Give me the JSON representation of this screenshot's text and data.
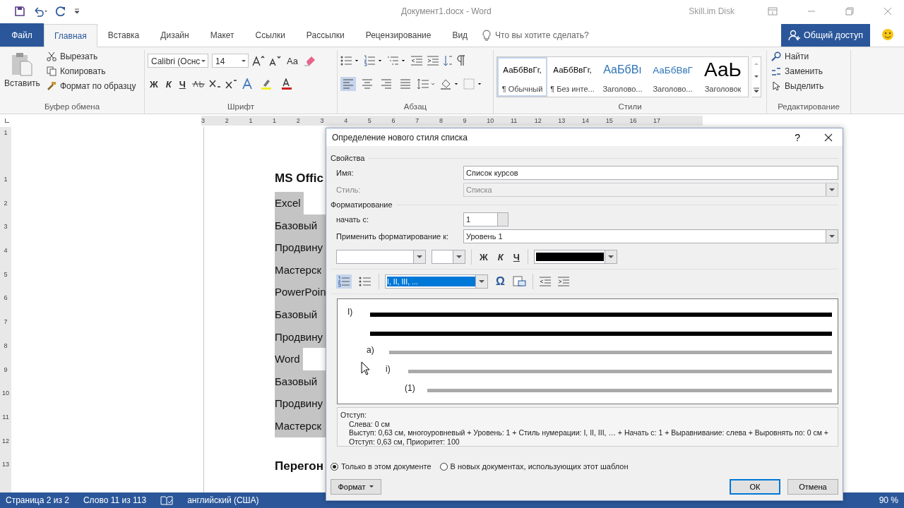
{
  "title_bar": {
    "title": "Документ1.docx - Word",
    "user": "Skill.im Disk"
  },
  "tabs": [
    {
      "label": "Файл",
      "kind": "file",
      "selected": false
    },
    {
      "label": "Главная",
      "kind": "tab",
      "selected": true
    },
    {
      "label": "Вставка",
      "kind": "tab",
      "selected": false
    },
    {
      "label": "Дизайн",
      "kind": "tab",
      "selected": false
    },
    {
      "label": "Макет",
      "kind": "tab",
      "selected": false
    },
    {
      "label": "Ссылки",
      "kind": "tab",
      "selected": false
    },
    {
      "label": "Рассылки",
      "kind": "tab",
      "selected": false
    },
    {
      "label": "Рецензирование",
      "kind": "tab",
      "selected": false
    },
    {
      "label": "Вид",
      "kind": "tab",
      "selected": false
    }
  ],
  "tell_me": {
    "placeholder": "Что вы хотите сделать?"
  },
  "share_button": "Общий доступ",
  "ribbon": {
    "clipboard": {
      "label": "Буфер обмена",
      "paste": "Вставить",
      "cut": "Вырезать",
      "copy": "Копировать",
      "format_painter": "Формат по образцу"
    },
    "font": {
      "label": "Шрифт",
      "name": "Calibri (Оснс",
      "size": "14",
      "case": "Аа",
      "bold": "Ж",
      "italic": "К",
      "underline": "Ч"
    },
    "paragraph": {
      "label": "Абзац",
      "alignments": [
        {
          "selected": true
        },
        {
          "selected": false
        },
        {
          "selected": false
        },
        {
          "selected": false
        }
      ]
    },
    "styles": {
      "label": "Стили",
      "items": [
        {
          "sample": "АаБбВвГг,",
          "name": "¶ Обычный",
          "kind": "normal",
          "selected": true
        },
        {
          "sample": "АаБбВвГг,",
          "name": "¶ Без инте...",
          "kind": "normal",
          "selected": false
        },
        {
          "sample": "АаБбВı",
          "name": "Заголово...",
          "kind": "heading1",
          "selected": false
        },
        {
          "sample": "АаБбВвГ",
          "name": "Заголово...",
          "kind": "heading2",
          "selected": false
        },
        {
          "sample": "АаЬ",
          "name": "Заголовок",
          "kind": "title",
          "selected": false
        }
      ]
    },
    "editing": {
      "label": "Редактирование",
      "find": "Найти",
      "replace": "Заменить",
      "select": "Выделить"
    }
  },
  "ruler": {
    "horizontal": [
      "3",
      "2",
      "1",
      "1",
      "2",
      "3",
      "4",
      "5",
      "6",
      "7",
      "8",
      "9",
      "10",
      "11",
      "12",
      "13",
      "14",
      "15",
      "16",
      "17"
    ],
    "vertical": [
      "1",
      "1",
      "2",
      "3",
      "4",
      "5",
      "6",
      "7",
      "8",
      "9",
      "10",
      "11",
      "12",
      "13"
    ]
  },
  "document": {
    "blocks": [
      {
        "text": "MS Offic",
        "kind": "heading",
        "selected": false
      },
      {
        "text": "Excel",
        "kind": "group",
        "selected": true
      },
      {
        "text": "Базовый",
        "kind": "item",
        "selected": true
      },
      {
        "text": "Продвину",
        "kind": "item",
        "selected": true
      },
      {
        "text": "Мастерск",
        "kind": "item",
        "selected": true
      },
      {
        "text": "PowerPoin",
        "kind": "item",
        "selected": true
      },
      {
        "text": "Базовый",
        "kind": "item",
        "selected": true
      },
      {
        "text": "Продвину",
        "kind": "item",
        "selected": true
      },
      {
        "text": "Word",
        "kind": "group",
        "selected": true
      },
      {
        "text": "Базовый",
        "kind": "item",
        "selected": true
      },
      {
        "text": "Продвину",
        "kind": "item",
        "selected": true
      },
      {
        "text": "Мастерск",
        "kind": "item",
        "selected": true
      },
      {
        "text": "Перегон",
        "kind": "heading",
        "selected": false
      }
    ]
  },
  "dialog": {
    "title": "Определение нового стиля списка",
    "help": "?",
    "properties": {
      "heading": "Свойства",
      "name_label": "Имя:",
      "name_value": "Список курсов",
      "style_label": "Стиль:",
      "style_value": "Списка",
      "style_disabled": true
    },
    "formatting": {
      "heading": "Форматирование",
      "start_label": "начать с:",
      "start_value": "1",
      "apply_label": "Применить форматирование к:",
      "apply_value": "Уровень 1",
      "bold": "Ж",
      "italic": "К",
      "underline": "Ч",
      "color": "#000000",
      "numbered_selected": true,
      "bulleted_selected": false,
      "number_style": "I, II, III, ...",
      "omega": "Ω"
    },
    "preview": [
      {
        "marker": "I)",
        "active": true,
        "children": [
          {
            "marker": "a)",
            "active": false,
            "children": [
              {
                "marker": "i)",
                "active": false,
                "children": [
                  {
                    "marker": "(1)",
                    "active": false
                  }
                ]
              }
            ]
          }
        ]
      }
    ],
    "description": [
      "Отступ:",
      "Слева:  0 см",
      "Выступ:  0,63 см, многоуровневый + Уровень: 1 + Стиль нумерации: I, II, III, … + Начать с: 1 + Выравнивание: слева + Выровнять по:  0 см + Отступ:  0,63 см, Приоритет: 100"
    ],
    "scope": [
      {
        "label": "Только в этом документе",
        "selected": true
      },
      {
        "label": "В новых документах, использующих этот шаблон",
        "selected": false
      }
    ],
    "format_button": "Формат",
    "ok": "ОК",
    "cancel": "Отмена"
  },
  "status_bar": {
    "page": "Страница 2 из 2",
    "words": "Слово 11 из 113",
    "language": "английский (США)",
    "zoom": "90 %"
  }
}
